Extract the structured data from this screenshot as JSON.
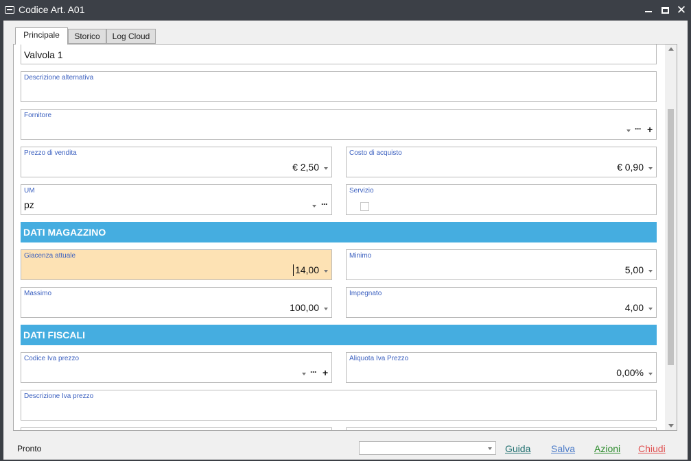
{
  "window": {
    "title": "Codice Art. A01"
  },
  "tabs": [
    {
      "label": "Principale"
    },
    {
      "label": "Storico"
    },
    {
      "label": "Log Cloud"
    }
  ],
  "form": {
    "descrizione_value": "Valvola 1",
    "descrizione_alt": {
      "label": "Descrizione alternativa",
      "value": ""
    },
    "fornitore": {
      "label": "Fornitore",
      "value": ""
    },
    "prezzo_vendita": {
      "label": "Prezzo di vendita",
      "value": "€ 2,50"
    },
    "costo_acquisto": {
      "label": "Costo di acquisto",
      "value": "€ 0,90"
    },
    "um": {
      "label": "UM",
      "value": "pz"
    },
    "servizio": {
      "label": "Servizio",
      "checked": false
    },
    "section_magazzino": "DATI MAGAZZINO",
    "giacenza": {
      "label": "Giacenza attuale",
      "value": "14,00"
    },
    "minimo": {
      "label": "Minimo",
      "value": "5,00"
    },
    "massimo": {
      "label": "Massimo",
      "value": "100,00"
    },
    "impegnato": {
      "label": "Impegnato",
      "value": "4,00"
    },
    "section_fiscali": "DATI FISCALI",
    "codice_iva": {
      "label": "Codice Iva prezzo",
      "value": ""
    },
    "aliquota_iva": {
      "label": "Aliquota Iva Prezzo",
      "value": "0,00%"
    },
    "descrizione_iva": {
      "label": "Descrizione Iva prezzo",
      "value": ""
    }
  },
  "statusbar": {
    "status": "Pronto",
    "combo_value": "",
    "links": {
      "guida": "Guida",
      "salva": "Salva",
      "azioni": "Azioni",
      "chiudi": "Chiudi"
    }
  },
  "colors": {
    "section_header": "#45ade0",
    "highlight_field": "#fde2b4",
    "label_blue": "#3a5fbf",
    "guida": "#1e6e6e",
    "salva": "#4a7ac8",
    "azioni": "#2a8a2a",
    "chiudi": "#e05050"
  }
}
